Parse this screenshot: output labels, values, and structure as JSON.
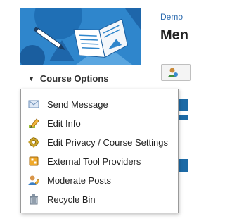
{
  "sidebar": {
    "course_options_label": "Course Options"
  },
  "main": {
    "breadcrumb": "Demo",
    "heading": "Men"
  },
  "course_menu": {
    "items": [
      {
        "label": "Send Message",
        "icon": "envelope-icon"
      },
      {
        "label": "Edit Info",
        "icon": "pencil-icon"
      },
      {
        "label": "Edit Privacy / Course Settings",
        "icon": "gear-icon"
      },
      {
        "label": "External Tool Providers",
        "icon": "puzzle-icon"
      },
      {
        "label": "Moderate Posts",
        "icon": "user-edit-icon"
      },
      {
        "label": "Recycle Bin",
        "icon": "recycle-bin-icon"
      }
    ]
  },
  "colors": {
    "banner": "#2f86cc",
    "link": "#2f6db0",
    "accent_bar": "#1c6aa6"
  }
}
